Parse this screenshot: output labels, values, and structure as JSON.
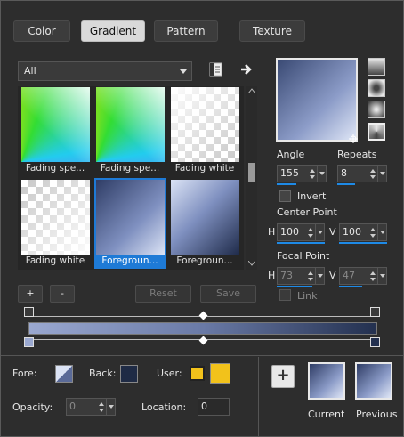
{
  "tabs": [
    {
      "label": "Color",
      "active": false
    },
    {
      "label": "Gradient",
      "active": true
    },
    {
      "label": "Pattern",
      "active": false
    },
    {
      "label": "Texture",
      "active": false
    }
  ],
  "category_dropdown": {
    "value": "All"
  },
  "gradients": [
    {
      "caption": "Fading spe..."
    },
    {
      "caption": "Fading spe..."
    },
    {
      "caption": "Fading white"
    },
    {
      "caption": "Fading white"
    },
    {
      "caption": "Foregroun...",
      "selected": true
    },
    {
      "caption": "Foregroun..."
    }
  ],
  "list_buttons": {
    "add": "+",
    "remove": "-",
    "reset": "Reset",
    "save": "Save"
  },
  "angle": {
    "label": "Angle",
    "value": "155"
  },
  "repeats": {
    "label": "Repeats",
    "value": "8"
  },
  "invert": {
    "label": "Invert",
    "checked": false
  },
  "center_point": {
    "label": "Center Point",
    "h_label": "H",
    "h_value": "100",
    "v_label": "V",
    "v_value": "100"
  },
  "focal_point": {
    "label": "Focal Point",
    "h_label": "H",
    "h_value": "73",
    "v_label": "V",
    "v_value": "47"
  },
  "link": {
    "label": "Link",
    "checked": false
  },
  "bottom": {
    "fore_label": "Fore:",
    "back_label": "Back:",
    "user_label": "User:",
    "opacity_label": "Opacity:",
    "opacity_value": "0",
    "location_label": "Location:",
    "location_value": "0",
    "add_symbol": "+",
    "current_label": "Current",
    "previous_label": "Previous"
  },
  "colors": {
    "accent": "#1e7ad6",
    "user_swatch": "#f2c21b",
    "dialog_bg": "#2d2d2d"
  }
}
